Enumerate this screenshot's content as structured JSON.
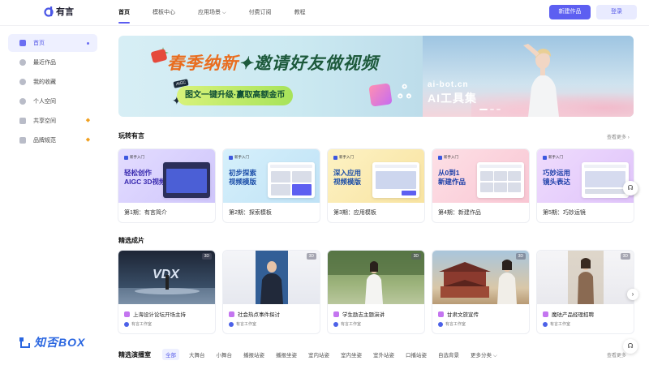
{
  "app": {
    "logo_text": "有言",
    "brand_color": "#5d5ff1"
  },
  "nav": {
    "items": [
      {
        "label": "首页",
        "active": true
      },
      {
        "label": "模板中心",
        "active": false
      },
      {
        "label": "应用场景",
        "active": false,
        "has_dropdown": true
      },
      {
        "label": "付费订阅",
        "active": false
      },
      {
        "label": "教程",
        "active": false
      }
    ],
    "new_button": "新建作品",
    "login_button": "登录"
  },
  "sidebar": {
    "items": [
      {
        "label": "首页",
        "icon": "home-icon",
        "active": true
      },
      {
        "label": "最近作品",
        "icon": "clock-icon",
        "active": false
      },
      {
        "label": "我的收藏",
        "icon": "star-icon",
        "active": false
      },
      {
        "label": "个人空间",
        "icon": "user-icon",
        "active": false
      },
      {
        "label": "共享空间",
        "icon": "grid-icon",
        "active": false,
        "badge": "diamond-icon"
      },
      {
        "label": "品牌规范",
        "icon": "crown-icon",
        "active": false,
        "badge": "diamond-icon"
      }
    ]
  },
  "banner": {
    "title_part1": "春季纳新",
    "title_sep": "✦",
    "title_part2": "邀请好友做视频",
    "subtitle": "图文一键升级·赢取高额金币",
    "tag": "AIGC",
    "ai_url": "ai-bot.cn",
    "ai_tool": "AI工具集"
  },
  "play_section": {
    "title": "玩转有言",
    "see_more": "查看更多",
    "cards": [
      {
        "brand": "新手入门",
        "head1": "轻松创作",
        "head2": "AIGC 3D视频",
        "label": "第1期：有言简介",
        "bg": "#d9d2fb"
      },
      {
        "brand": "新手入门",
        "head1": "初步探索",
        "head2": "视频模版",
        "label": "第2期：探索模板",
        "bg": "#cde9f8"
      },
      {
        "brand": "新手入门",
        "head1": "深入应用",
        "head2": "视频模版",
        "label": "第3期：应用模板",
        "bg": "#fbeeb9"
      },
      {
        "brand": "新手入门",
        "head1": "从0到1",
        "head2": "新建作品",
        "label": "第4期：新建作品",
        "bg": "#fbd3dd"
      },
      {
        "brand": "新手入门",
        "head1": "巧妙运用",
        "head2": "镜头表达",
        "label": "第5期：巧妙运镜",
        "bg": "#ead2fb"
      }
    ]
  },
  "works_section": {
    "title": "精选成片",
    "badge_3d": "3D",
    "works": [
      {
        "title": "上海设计论坛开场主持",
        "author": "有言工作室"
      },
      {
        "title": "社会热点事件探讨",
        "author": "有言工作室"
      },
      {
        "title": "学生励志主题演讲",
        "author": "有言工作室"
      },
      {
        "title": "甘肃文旅宣传",
        "author": "有言工作室"
      },
      {
        "title": "魔珐产品经理招聘",
        "author": "有言工作室"
      }
    ]
  },
  "filter_section": {
    "title": "精选演播室",
    "chips": [
      "全部",
      "大舞台",
      "小舞台",
      "播报站姿",
      "播报坐姿",
      "室内站姿",
      "室内坐姿",
      "室外站姿",
      "口播站姿",
      "自选背景",
      "更多分类"
    ],
    "see_more": "查看更多"
  },
  "watermark": {
    "text": "知否BOX"
  }
}
